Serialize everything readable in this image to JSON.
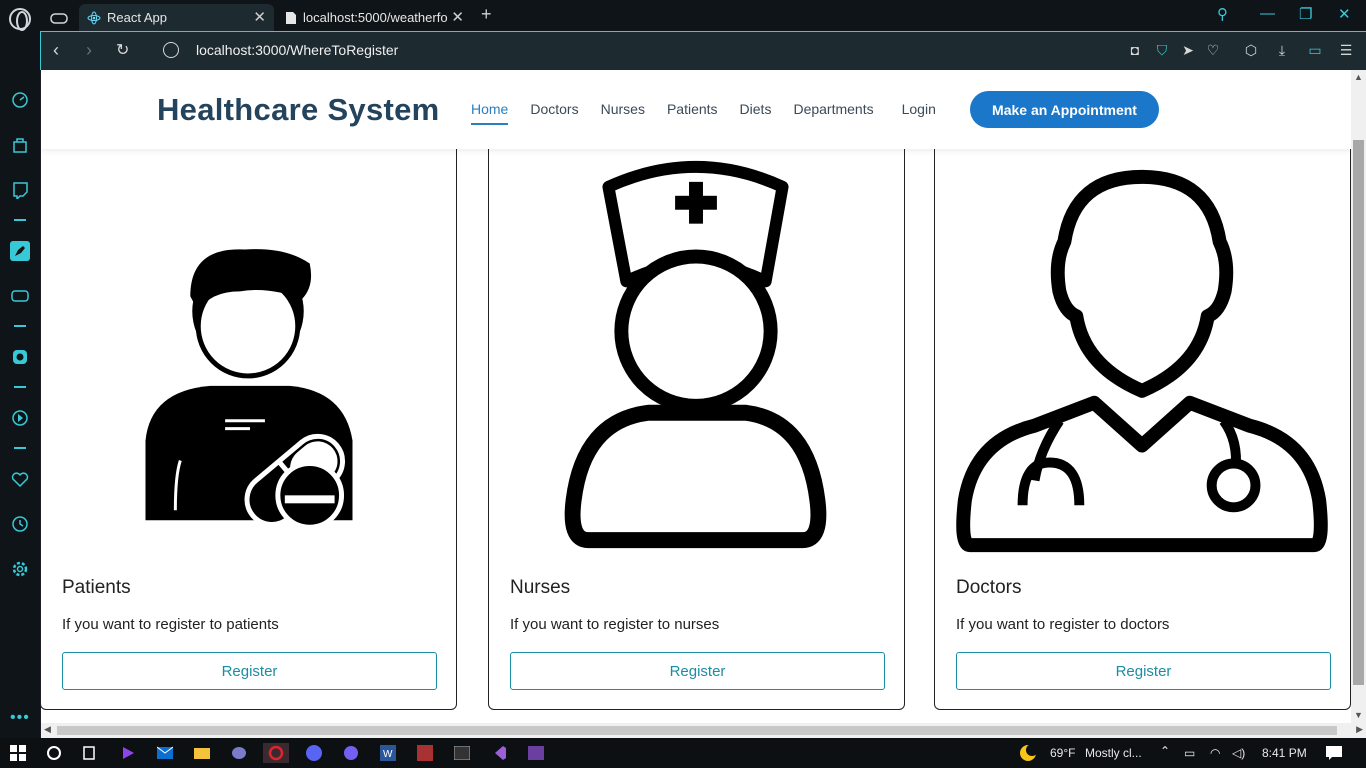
{
  "browser": {
    "tabs": [
      {
        "title": "React App",
        "active": true
      },
      {
        "title": "localhost:5000/weatherfore",
        "active": false
      }
    ],
    "url": "localhost:3000/WhereToRegister"
  },
  "navbar": {
    "brand": "Healthcare System",
    "links": [
      "Home",
      "Doctors",
      "Nurses",
      "Patients",
      "Diets",
      "Departments",
      "Login"
    ],
    "active_link": "Home",
    "cta": "Make an Appointment"
  },
  "cards": [
    {
      "title": "Patients",
      "text": "If you want to register to patients",
      "button": "Register",
      "icon": "patient-icon"
    },
    {
      "title": "Nurses",
      "text": "If you want to register to nurses",
      "button": "Register",
      "icon": "nurse-icon"
    },
    {
      "title": "Doctors",
      "text": "If you want to register to doctors",
      "button": "Register",
      "icon": "doctor-icon"
    }
  ],
  "taskbar": {
    "weather": "69°F",
    "weather_desc": "Mostly cl...",
    "time": "8:41 PM"
  },
  "colors": {
    "accent": "#1a77c9",
    "brand_text": "#24445e",
    "register_border": "#1b8da3",
    "browser_accent": "#38c9d6"
  }
}
